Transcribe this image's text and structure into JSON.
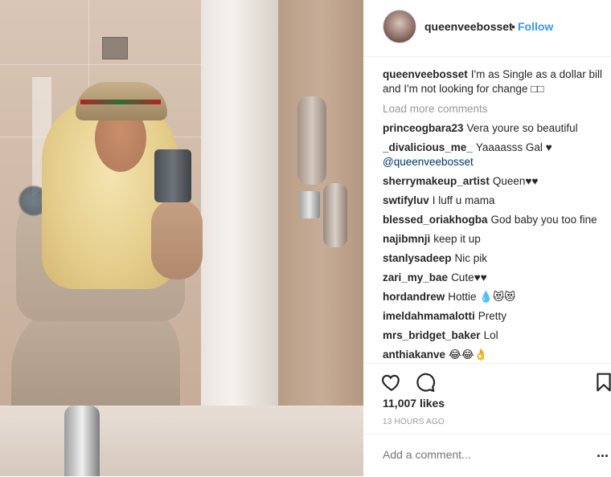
{
  "header": {
    "username": "queenveebosset",
    "separator": "•",
    "follow_label": "Follow"
  },
  "caption": {
    "username": "queenveebosset",
    "text": "I'm as Single as a dollar bill and I'm not looking for change □□"
  },
  "load_more_label": "Load more comments",
  "comments": [
    {
      "user": "princeogbara23",
      "text": "Vera youre so beautiful"
    },
    {
      "user": "_divalicious_me_",
      "text": "Yaaaasss Gal ♥"
    },
    {
      "user": "",
      "text": "@queenveebosset"
    },
    {
      "user": "sherrymakeup_artist",
      "text": "Queen♥♥"
    },
    {
      "user": "swtifyluv",
      "text": "I luff u mama"
    },
    {
      "user": "blessed_oriakhogba",
      "text": "God baby you too fine"
    },
    {
      "user": "najibmnji",
      "text": "keep it up"
    },
    {
      "user": "stanlysadeep",
      "text": "Nic pik"
    },
    {
      "user": "zari_my_bae",
      "text": "Cute♥♥"
    },
    {
      "user": "hordandrew",
      "text": "Hottie 💧😻😻"
    },
    {
      "user": "imeldahmamalotti",
      "text": "Pretty"
    },
    {
      "user": "mrs_bridget_baker",
      "text": "Lol"
    },
    {
      "user": "anthiakanve",
      "text": "😂😂👌"
    }
  ],
  "likes": "11,007 likes",
  "timestamp": "13 HOURS AGO",
  "add_comment": {
    "placeholder": "Add a comment..."
  },
  "more_label": "...",
  "icons": {
    "like": "heart-icon",
    "comment": "comment-icon",
    "save": "bookmark-icon"
  },
  "colors": {
    "accent": "#3897f0",
    "text": "#262626",
    "muted": "#999999"
  }
}
